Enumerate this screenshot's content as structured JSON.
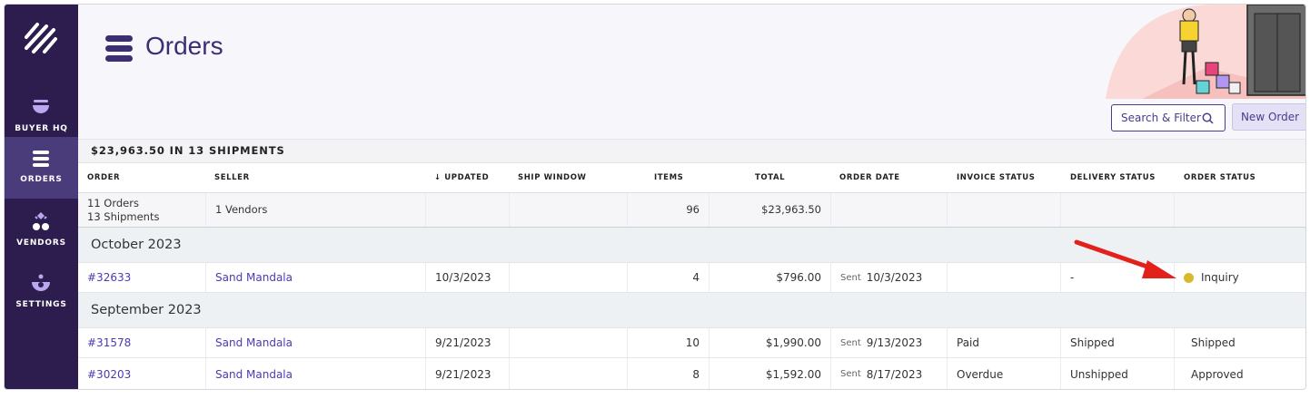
{
  "sidebar": {
    "items": [
      {
        "label": "BUYER HQ",
        "icon": "bowl-icon"
      },
      {
        "label": "ORDERS",
        "icon": "stack-icon",
        "active": true
      },
      {
        "label": "VENDORS",
        "icon": "diamonds-icon"
      },
      {
        "label": "SETTINGS",
        "icon": "settings-bowl-icon"
      }
    ]
  },
  "header": {
    "title": "Orders",
    "search_filter_label": "Search & Filter",
    "new_order_label": "New Order"
  },
  "summary": "$23,963.50 IN 13 SHIPMENTS",
  "table": {
    "columns": [
      "ORDER",
      "SELLER",
      "↓ UPDATED",
      "SHIP WINDOW",
      "ITEMS",
      "TOTAL",
      "ORDER DATE",
      "INVOICE STATUS",
      "DELIVERY STATUS",
      "ORDER STATUS"
    ],
    "totals": {
      "orders": "11 Orders",
      "shipments": "13 Shipments",
      "vendors": "1 Vendors",
      "items": "96",
      "total": "$23,963.50"
    },
    "groups": [
      {
        "label": "October 2023",
        "rows": [
          {
            "order": "#32633",
            "seller": "Sand Mandala",
            "updated": "10/3/2023",
            "ship_window": "",
            "items": "4",
            "total": "$796.00",
            "sent_label": "Sent",
            "order_date": "10/3/2023",
            "invoice_status": "",
            "delivery_status": "-",
            "order_status": "Inquiry"
          }
        ]
      },
      {
        "label": "September 2023",
        "rows": [
          {
            "order": "#31578",
            "seller": "Sand Mandala",
            "updated": "9/21/2023",
            "ship_window": "",
            "items": "10",
            "total": "$1,990.00",
            "sent_label": "Sent",
            "order_date": "9/13/2023",
            "invoice_status": "Paid",
            "delivery_status": "Shipped",
            "order_status": "Shipped"
          },
          {
            "order": "#30203",
            "seller": "Sand Mandala",
            "updated": "9/21/2023",
            "ship_window": "",
            "items": "8",
            "total": "$1,592.00",
            "sent_label": "Sent",
            "order_date": "8/17/2023",
            "invoice_status": "Overdue",
            "delivery_status": "Unshipped",
            "order_status": "Approved"
          }
        ]
      }
    ]
  },
  "colors": {
    "sidebar_bg": "#2c1d4e",
    "sidebar_active": "#4a3b7a",
    "accent": "#4a3bb0",
    "inquiry_dot": "#d9b92a",
    "annotation_arrow": "#e3211c"
  }
}
